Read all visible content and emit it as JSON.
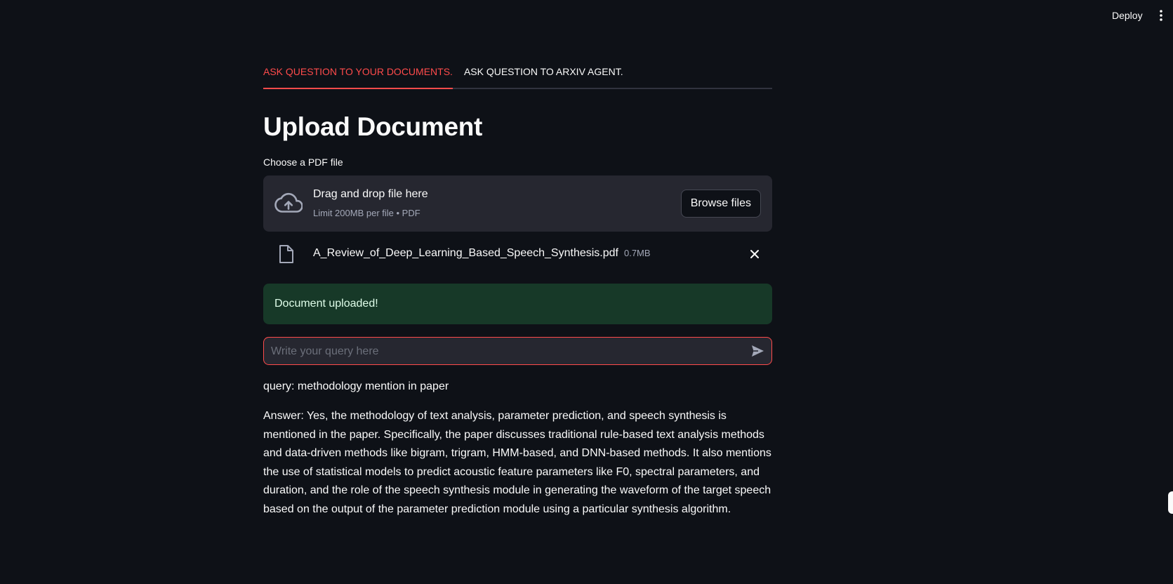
{
  "header": {
    "deploy_label": "Deploy",
    "menu_icon": "vertical-dots-icon"
  },
  "tabs": [
    {
      "label": "ASK QUESTION TO YOUR DOCUMENTS.",
      "active": true
    },
    {
      "label": "ASK QUESTION TO ARXIV AGENT.",
      "active": false
    }
  ],
  "page": {
    "title": "Upload Document"
  },
  "uploader": {
    "label": "Choose a PDF file",
    "drop_text": "Drag and drop file here",
    "limit_text": "Limit 200MB per file • PDF",
    "browse_label": "Browse files",
    "icon": "cloud-upload-icon"
  },
  "uploaded_file": {
    "name": "A_Review_of_Deep_Learning_Based_Speech_Synthesis.pdf",
    "size": "0.7MB",
    "icon": "file-icon",
    "remove_icon": "close-icon"
  },
  "status": {
    "message": "Document uploaded!"
  },
  "chat_input": {
    "placeholder": "Write your query here",
    "value": "",
    "send_icon": "send-icon"
  },
  "result": {
    "query": "query: methodology mention in paper",
    "answer": "Answer: Yes, the methodology of text analysis, parameter prediction, and speech synthesis is mentioned in the paper. Specifically, the paper discusses traditional rule-based text analysis methods and data-driven methods like bigram, trigram, HMM-based, and DNN-based methods. It also mentions the use of statistical models to predict acoustic feature parameters like F0, spectral parameters, and duration, and the role of the speech synthesis module in generating the waveform of the target speech based on the output of the parameter prediction module using a particular synthesis algorithm."
  },
  "colors": {
    "background": "#0e1117",
    "accent": "#ff4b4b",
    "surface": "#262730",
    "success_bg": "#173928",
    "text": "#fafafa",
    "muted": "#a3a8b8"
  }
}
